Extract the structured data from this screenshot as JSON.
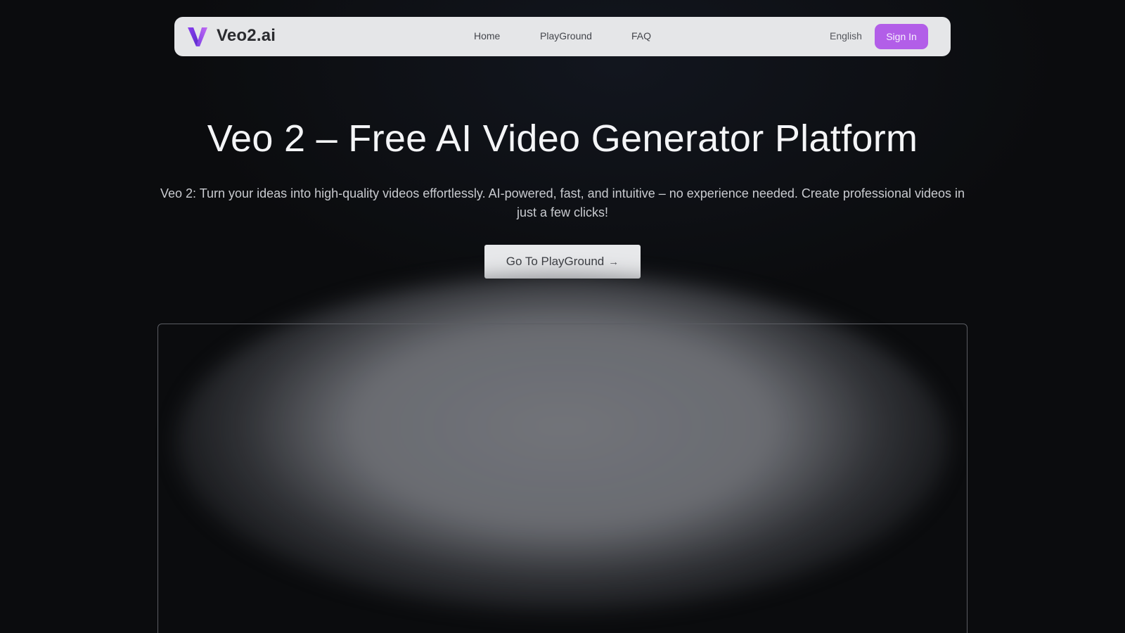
{
  "nav": {
    "brand": "Veo2.ai",
    "logo_icon": "v-logo-icon",
    "links": [
      {
        "label": "Home"
      },
      {
        "label": "PlayGround"
      },
      {
        "label": "FAQ"
      }
    ],
    "language": "English",
    "sign_in": "Sign In"
  },
  "hero": {
    "title": "Veo 2 – Free AI Video Generator Platform",
    "subtitle": "Veo 2: Turn your ideas into high-quality videos effortlessly. AI-powered, fast, and intuitive – no experience needed. Create professional videos in just a few clicks!",
    "cta_label": "Go To PlayGround",
    "cta_icon": "arrow-right-icon"
  },
  "colors": {
    "accent": "#b25ee8",
    "background": "#0b0c0e",
    "nav_background": "#e5e6e8"
  }
}
